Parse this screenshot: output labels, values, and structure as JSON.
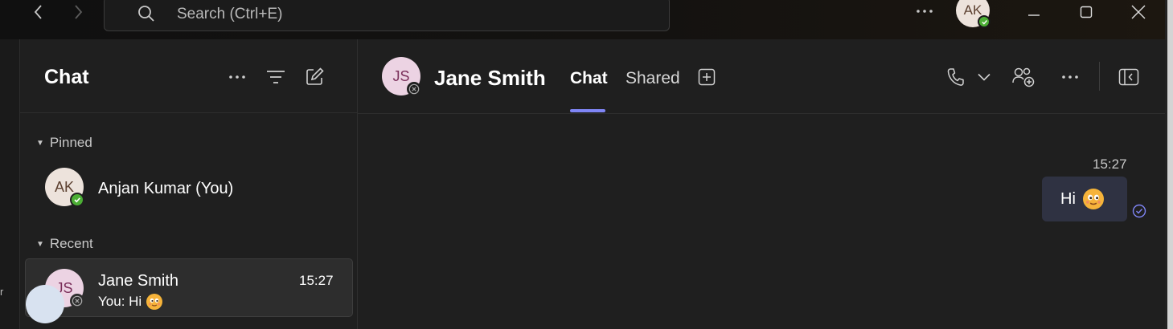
{
  "titlebar": {
    "search_placeholder": "Search (Ctrl+E)",
    "user_initials": "AK"
  },
  "rail": {
    "partial_text": "r"
  },
  "chat_list": {
    "title": "Chat",
    "pinned_label": "Pinned",
    "recent_label": "Recent",
    "pinned": [
      {
        "initials": "AK",
        "name": "Anjan Kumar (You)",
        "presence": "available"
      }
    ],
    "recent": [
      {
        "initials": "JS",
        "name": "Jane Smith",
        "time": "15:27",
        "preview": "You: Hi",
        "presence": "offline",
        "selected": true
      }
    ]
  },
  "conversation": {
    "initials": "JS",
    "name": "Jane Smith",
    "tabs": [
      {
        "label": "Chat",
        "active": true
      },
      {
        "label": "Shared",
        "active": false
      }
    ],
    "messages": [
      {
        "time": "15:27",
        "text": "Hi",
        "emoji": "smiling-face-emoji",
        "status": "seen"
      }
    ]
  },
  "colors": {
    "accent": "#7f85f5",
    "available": "#4caf35",
    "bubble": "#2f3242",
    "background": "#1f1f1f"
  },
  "icons": [
    "back-arrow-icon",
    "forward-arrow-icon",
    "search-icon",
    "more-icon",
    "minimize-icon",
    "maximize-icon",
    "close-icon",
    "filter-icon",
    "new-chat-icon",
    "add-tab-icon",
    "call-icon",
    "chevron-down-icon",
    "add-people-icon",
    "open-panel-icon",
    "read-receipt-icon"
  ]
}
